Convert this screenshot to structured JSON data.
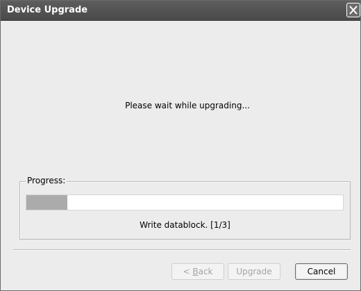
{
  "window": {
    "title": "Device Upgrade",
    "close_icon": "close-icon"
  },
  "message": "Please wait while upgrading...",
  "progress": {
    "label": "Progress:",
    "fraction": 0.13,
    "status": "Write datablock. [1/3]"
  },
  "buttons": {
    "back_label_prefix": "< ",
    "back_label_mnemonic": "B",
    "back_label_rest": "ack",
    "upgrade_label": "Upgrade",
    "cancel_label": "Cancel"
  },
  "colors": {
    "titlebar": "#555555",
    "progress_fill": "#ababab",
    "dialog_bg": "#ececec"
  }
}
